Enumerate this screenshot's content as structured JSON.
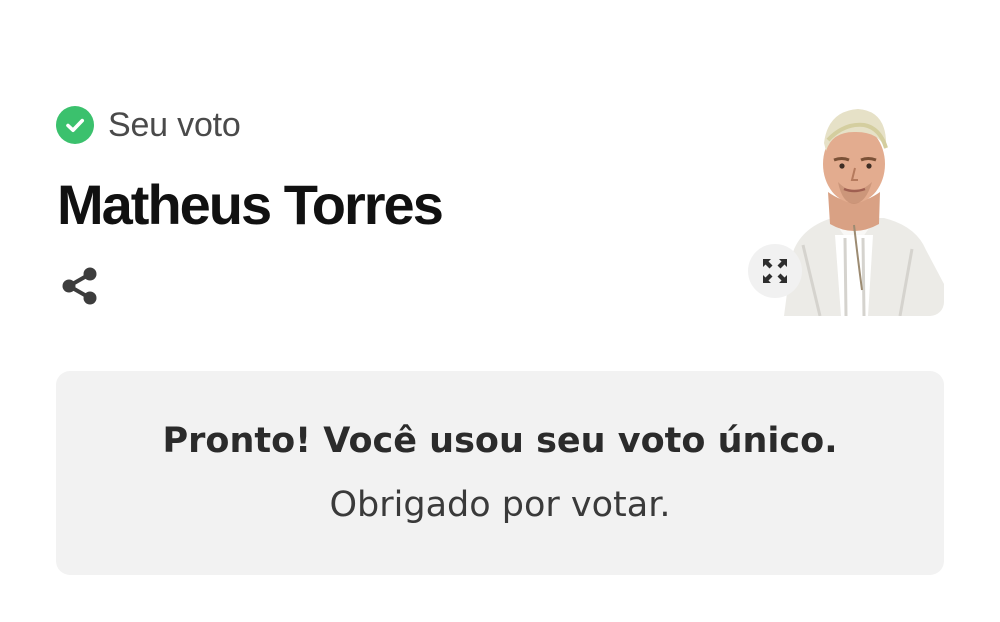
{
  "vote_status": {
    "label": "Seu voto",
    "icon": "check-circle-icon",
    "color": "#3bc16d"
  },
  "candidate": {
    "name": "Matheus Torres",
    "photo_alt": "Matheus Torres"
  },
  "actions": {
    "share_icon": "share-icon",
    "expand_icon": "expand-icon"
  },
  "message": {
    "strong": "Pronto! Você usou seu voto único.",
    "normal": "Obrigado por votar."
  }
}
